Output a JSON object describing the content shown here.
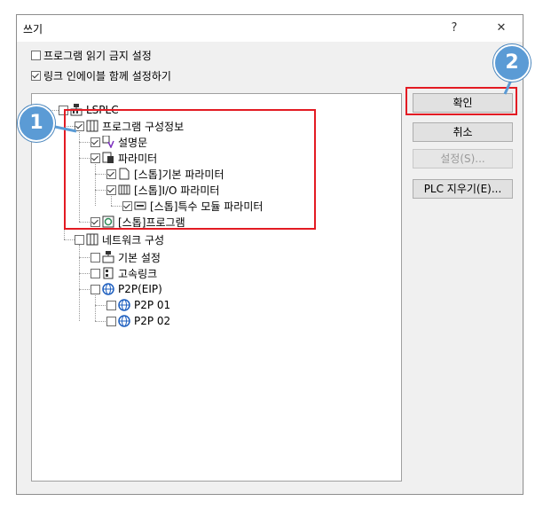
{
  "dialog": {
    "title": "쓰기",
    "help_label": "?",
    "close_label": "✕"
  },
  "options": [
    {
      "label": "프로그램 읽기 금지 설정",
      "checked": false
    },
    {
      "label": "링크 인에이블 함께 설정하기",
      "checked": true
    }
  ],
  "tree": {
    "root": "LSPLC",
    "items": [
      {
        "label": "프로그램 구성정보",
        "checked": true,
        "icon": "program-config-icon"
      },
      {
        "label": "설명문",
        "checked": true,
        "icon": "comment-icon"
      },
      {
        "label": "파라미터",
        "checked": true,
        "icon": "parameter-icon"
      },
      {
        "label": "[스톱]기본 파라미터",
        "checked": true,
        "icon": "document-icon"
      },
      {
        "label": "[스톱]I/O 파라미터",
        "checked": true,
        "icon": "io-module-icon"
      },
      {
        "label": "[스톱]특수 모듈 파라미터",
        "checked": true,
        "icon": "special-module-icon"
      },
      {
        "label": "[스톱]프로그램",
        "checked": true,
        "icon": "program-icon"
      },
      {
        "label": "네트워크 구성",
        "checked": false,
        "icon": "network-config-icon"
      },
      {
        "label": "기본 설정",
        "checked": false,
        "icon": "basic-setting-icon"
      },
      {
        "label": "고속링크",
        "checked": false,
        "icon": "highspeed-link-icon"
      },
      {
        "label": "P2P(EIP)",
        "checked": false,
        "icon": "globe-icon"
      },
      {
        "label": "P2P 01",
        "checked": false,
        "icon": "globe-icon"
      },
      {
        "label": "P2P 02",
        "checked": false,
        "icon": "globe-icon"
      }
    ]
  },
  "buttons": {
    "ok": "확인",
    "cancel": "취소",
    "settings": "설정(S)...",
    "plc_clear": "PLC 지우기(E)..."
  },
  "annotations": {
    "badge1": "1",
    "badge2": "2"
  },
  "colors": {
    "highlight_red": "#e31b23",
    "badge_blue": "#5b9bd5"
  }
}
